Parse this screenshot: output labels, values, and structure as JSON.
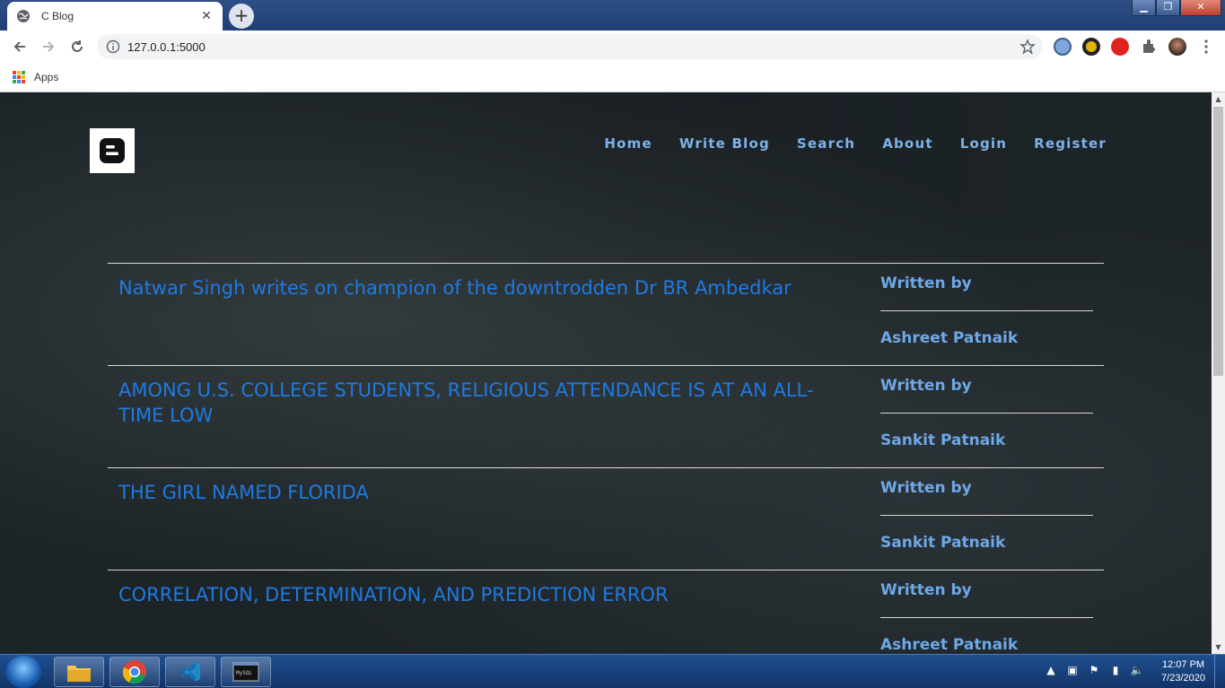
{
  "browser": {
    "tab_title": "C Blog",
    "url": "127.0.0.1:5000",
    "bookmarks_apps_label": "Apps"
  },
  "site": {
    "nav": [
      "Home",
      "Write Blog",
      "Search",
      "About",
      "Login",
      "Register"
    ],
    "posts": [
      {
        "title": "Natwar Singh writes on champion of the downtrodden Dr BR Ambedkar",
        "written_by": "Written by",
        "author": "Ashreet Patnaik"
      },
      {
        "title": "AMONG U.S. COLLEGE STUDENTS, RELIGIOUS ATTENDANCE IS AT AN ALL-TIME LOW",
        "written_by": "Written by",
        "author": "Sankit Patnaik"
      },
      {
        "title": "THE GIRL NAMED FLORIDA",
        "written_by": "Written by",
        "author": "Sankit Patnaik"
      },
      {
        "title": "CORRELATION, DETERMINATION, AND PREDICTION ERROR",
        "written_by": "Written by",
        "author": "Ashreet Patnaik"
      }
    ]
  },
  "taskbar": {
    "time": "12:07 PM",
    "date": "7/23/2020"
  },
  "colors": {
    "title_blue": "#1f7ae0",
    "nav_blue": "#7db3e8",
    "meta_blue": "#6ea8e6"
  }
}
